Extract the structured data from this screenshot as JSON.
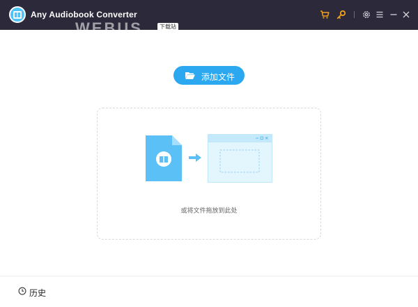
{
  "app": {
    "title": "Any Audiobook Converter",
    "watermark_text": "WEBUS",
    "watermark_tag": "下载站"
  },
  "titlebar": {
    "icons": [
      "cart-icon",
      "key-icon",
      "settings-icon",
      "menu-icon",
      "minimize-icon",
      "close-icon"
    ]
  },
  "main": {
    "add_button_label": "添加文件",
    "drop_hint": "或将文件拖放到此处"
  },
  "footer": {
    "history_label": "历史"
  },
  "colors": {
    "titlebar_bg": "#2c2a3a",
    "accent": "#2ba8f0",
    "orange_icon": "#f0a020"
  }
}
